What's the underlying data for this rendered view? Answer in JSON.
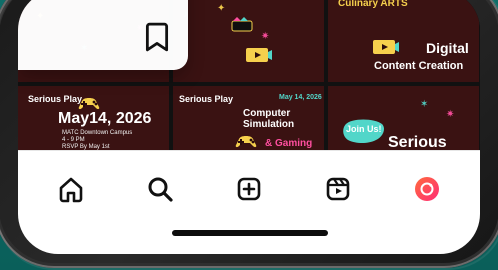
{
  "tiles": [
    {
      "id": "tile-1",
      "top_text": "",
      "date": "",
      "title": "",
      "subtitle": ""
    },
    {
      "id": "tile-2",
      "top_text": "",
      "date": "",
      "title": "",
      "subtitle": ""
    },
    {
      "id": "tile-3",
      "top_text": "Culinary ARTS",
      "date": "",
      "title": "Digital",
      "subtitle": "Content Creation"
    },
    {
      "id": "tile-4",
      "top_text": "Serious Play",
      "date": "May14, 2026",
      "title": "",
      "subtitle": "MATC Downtown Campus\n4 - 9 PM\nRSVP By May 1st"
    },
    {
      "id": "tile-5",
      "top_text": "Serious Play",
      "date": "May 14, 2026",
      "title": "Computer Simulation",
      "subtitle": "& Gaming"
    },
    {
      "id": "tile-6",
      "top_text": "Join Us!",
      "date": "",
      "title": "Serious",
      "subtitle": ""
    }
  ],
  "nav": {
    "items": [
      {
        "name": "home"
      },
      {
        "name": "search"
      },
      {
        "name": "create"
      },
      {
        "name": "reels"
      },
      {
        "name": "profile"
      }
    ]
  },
  "colors": {
    "tile_bg": "#3a1212",
    "accent_pink": "#ff4fa0",
    "accent_yellow": "#f6d04d",
    "accent_teal": "#52d6c9",
    "nav_icon": "#111111",
    "profile_gradient_a": "#ff6a3d",
    "profile_gradient_b": "#ff2d76"
  },
  "icons": {
    "bookmark": "bookmark-icon",
    "home": "home-icon",
    "search": "search-icon",
    "create": "plus-square-icon",
    "reels": "reels-icon",
    "profile": "profile-icon"
  }
}
